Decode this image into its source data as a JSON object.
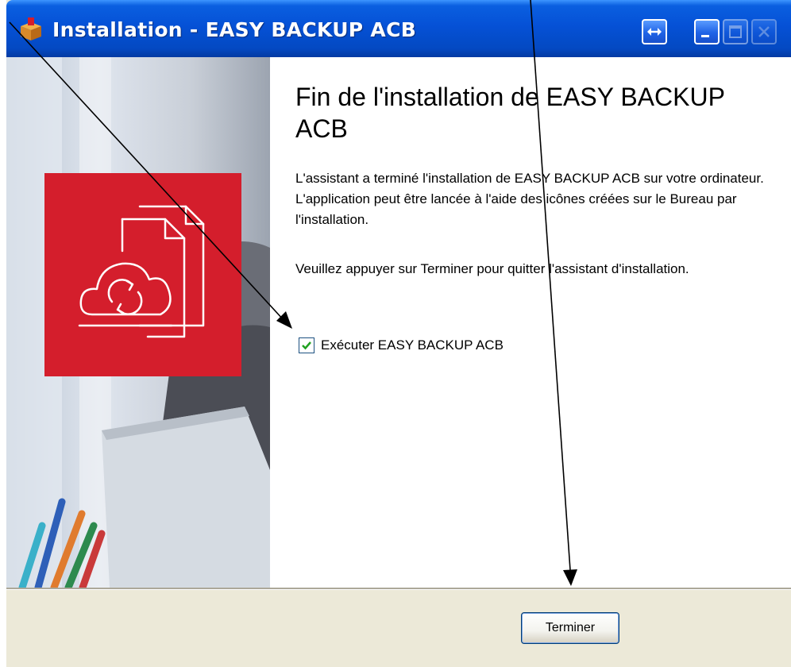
{
  "window": {
    "title": "Installation - EASY BACKUP ACB",
    "title_bar_color": "#0551d6"
  },
  "side_panel": {
    "logo_color": "#d41e2c",
    "logo_icon": "cloud-sync-documents-icon"
  },
  "content": {
    "heading": "Fin de l'installation de EASY BACKUP ACB",
    "paragraph1": "L'assistant a terminé l'installation de EASY BACKUP ACB sur votre ordinateur. L'application peut être lancée à l'aide des icônes créées sur le Bureau par l'installation.",
    "paragraph2": "Veuillez appuyer sur Terminer pour quitter l'assistant d'installation.",
    "run_checkbox": {
      "label": "Exécuter EASY BACKUP ACB",
      "checked": true
    }
  },
  "footer": {
    "finish_label": "Terminer"
  }
}
